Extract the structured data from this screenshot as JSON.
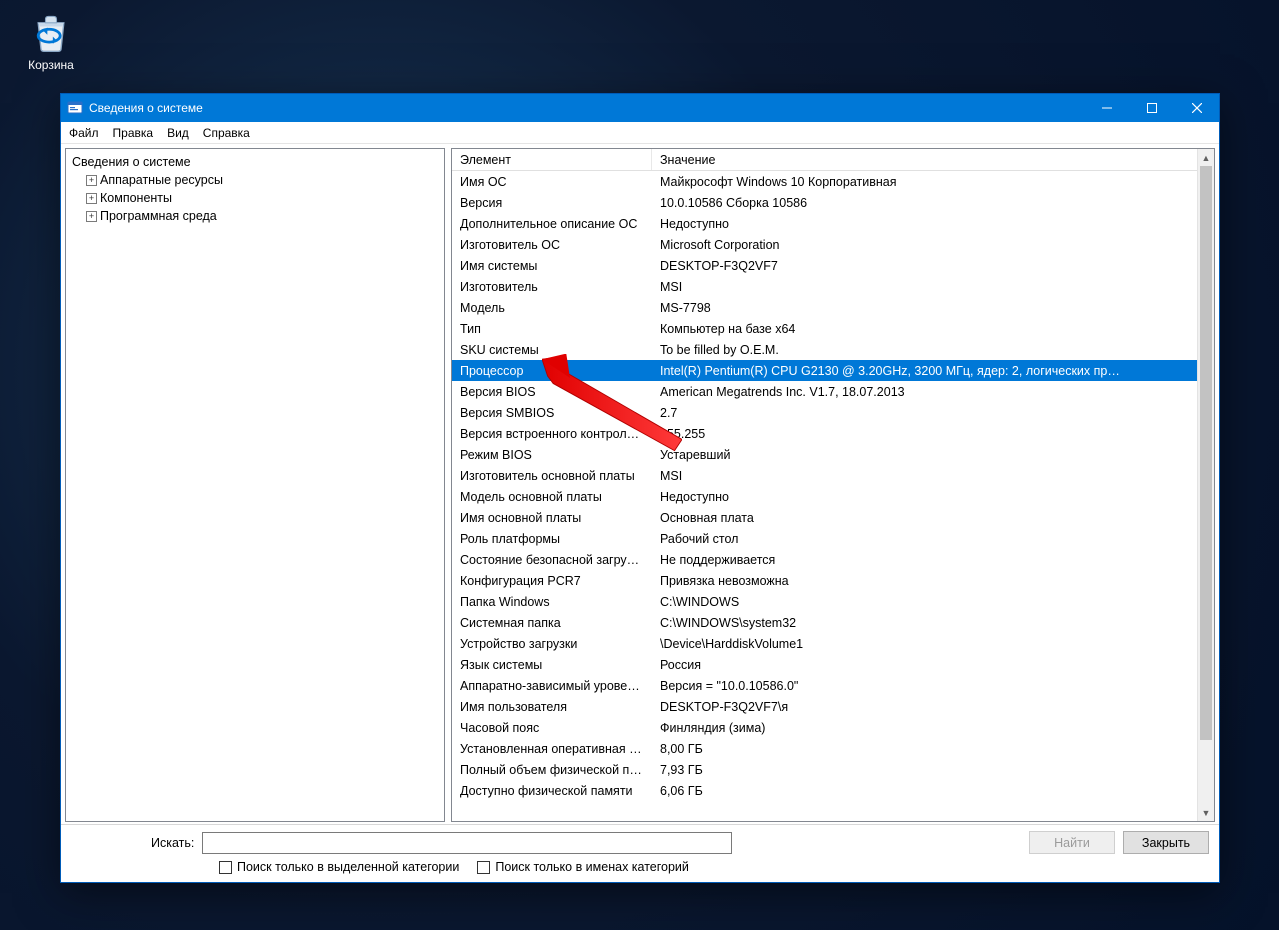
{
  "desktop": {
    "recycle_label": "Корзина"
  },
  "window": {
    "title": "Сведения о системе",
    "menu": [
      "Файл",
      "Правка",
      "Вид",
      "Справка"
    ],
    "tree": {
      "root": "Сведения о системе",
      "items": [
        "Аппаратные ресурсы",
        "Компоненты",
        "Программная среда"
      ]
    },
    "columns": {
      "element": "Элемент",
      "value": "Значение"
    },
    "selected_index": 9,
    "rows": [
      {
        "el": "Имя ОС",
        "val": "Майкрософт Windows 10 Корпоративная"
      },
      {
        "el": "Версия",
        "val": "10.0.10586 Сборка 10586"
      },
      {
        "el": "Дополнительное описание ОС",
        "val": "Недоступно"
      },
      {
        "el": "Изготовитель ОС",
        "val": "Microsoft Corporation"
      },
      {
        "el": "Имя системы",
        "val": "DESKTOP-F3Q2VF7"
      },
      {
        "el": "Изготовитель",
        "val": "MSI"
      },
      {
        "el": "Модель",
        "val": "MS-7798"
      },
      {
        "el": "Тип",
        "val": "Компьютер на базе x64"
      },
      {
        "el": "SKU системы",
        "val": "To be filled by O.E.M."
      },
      {
        "el": "Процессор",
        "val": "Intel(R) Pentium(R) CPU G2130 @ 3.20GHz, 3200 МГц, ядер: 2, логических пр…"
      },
      {
        "el": "Версия BIOS",
        "val": "American Megatrends Inc. V1.7, 18.07.2013"
      },
      {
        "el": "Версия SMBIOS",
        "val": "2.7"
      },
      {
        "el": "Версия встроенного контрол…",
        "val": "255.255"
      },
      {
        "el": "Режим BIOS",
        "val": "Устаревший"
      },
      {
        "el": "Изготовитель основной платы",
        "val": "MSI"
      },
      {
        "el": "Модель основной платы",
        "val": "Недоступно"
      },
      {
        "el": "Имя основной платы",
        "val": "Основная плата"
      },
      {
        "el": "Роль платформы",
        "val": "Рабочий стол"
      },
      {
        "el": "Состояние безопасной загруз…",
        "val": "Не поддерживается"
      },
      {
        "el": "Конфигурация PCR7",
        "val": "Привязка невозможна"
      },
      {
        "el": "Папка Windows",
        "val": "C:\\WINDOWS"
      },
      {
        "el": "Системная папка",
        "val": "C:\\WINDOWS\\system32"
      },
      {
        "el": "Устройство загрузки",
        "val": "\\Device\\HarddiskVolume1"
      },
      {
        "el": "Язык системы",
        "val": "Россия"
      },
      {
        "el": "Аппаратно-зависимый уровен…",
        "val": "Версия = \"10.0.10586.0\""
      },
      {
        "el": "Имя пользователя",
        "val": "DESKTOP-F3Q2VF7\\я"
      },
      {
        "el": "Часовой пояс",
        "val": "Финляндия (зима)"
      },
      {
        "el": "Установленная оперативная п…",
        "val": "8,00 ГБ"
      },
      {
        "el": "Полный объем физической па…",
        "val": "7,93 ГБ"
      },
      {
        "el": "Доступно физической памяти",
        "val": "6,06 ГБ"
      }
    ],
    "search": {
      "label": "Искать:",
      "find_btn": "Найти",
      "close_btn": "Закрыть",
      "cb1": "Поиск только в выделенной категории",
      "cb2": "Поиск только в именах категорий"
    }
  }
}
